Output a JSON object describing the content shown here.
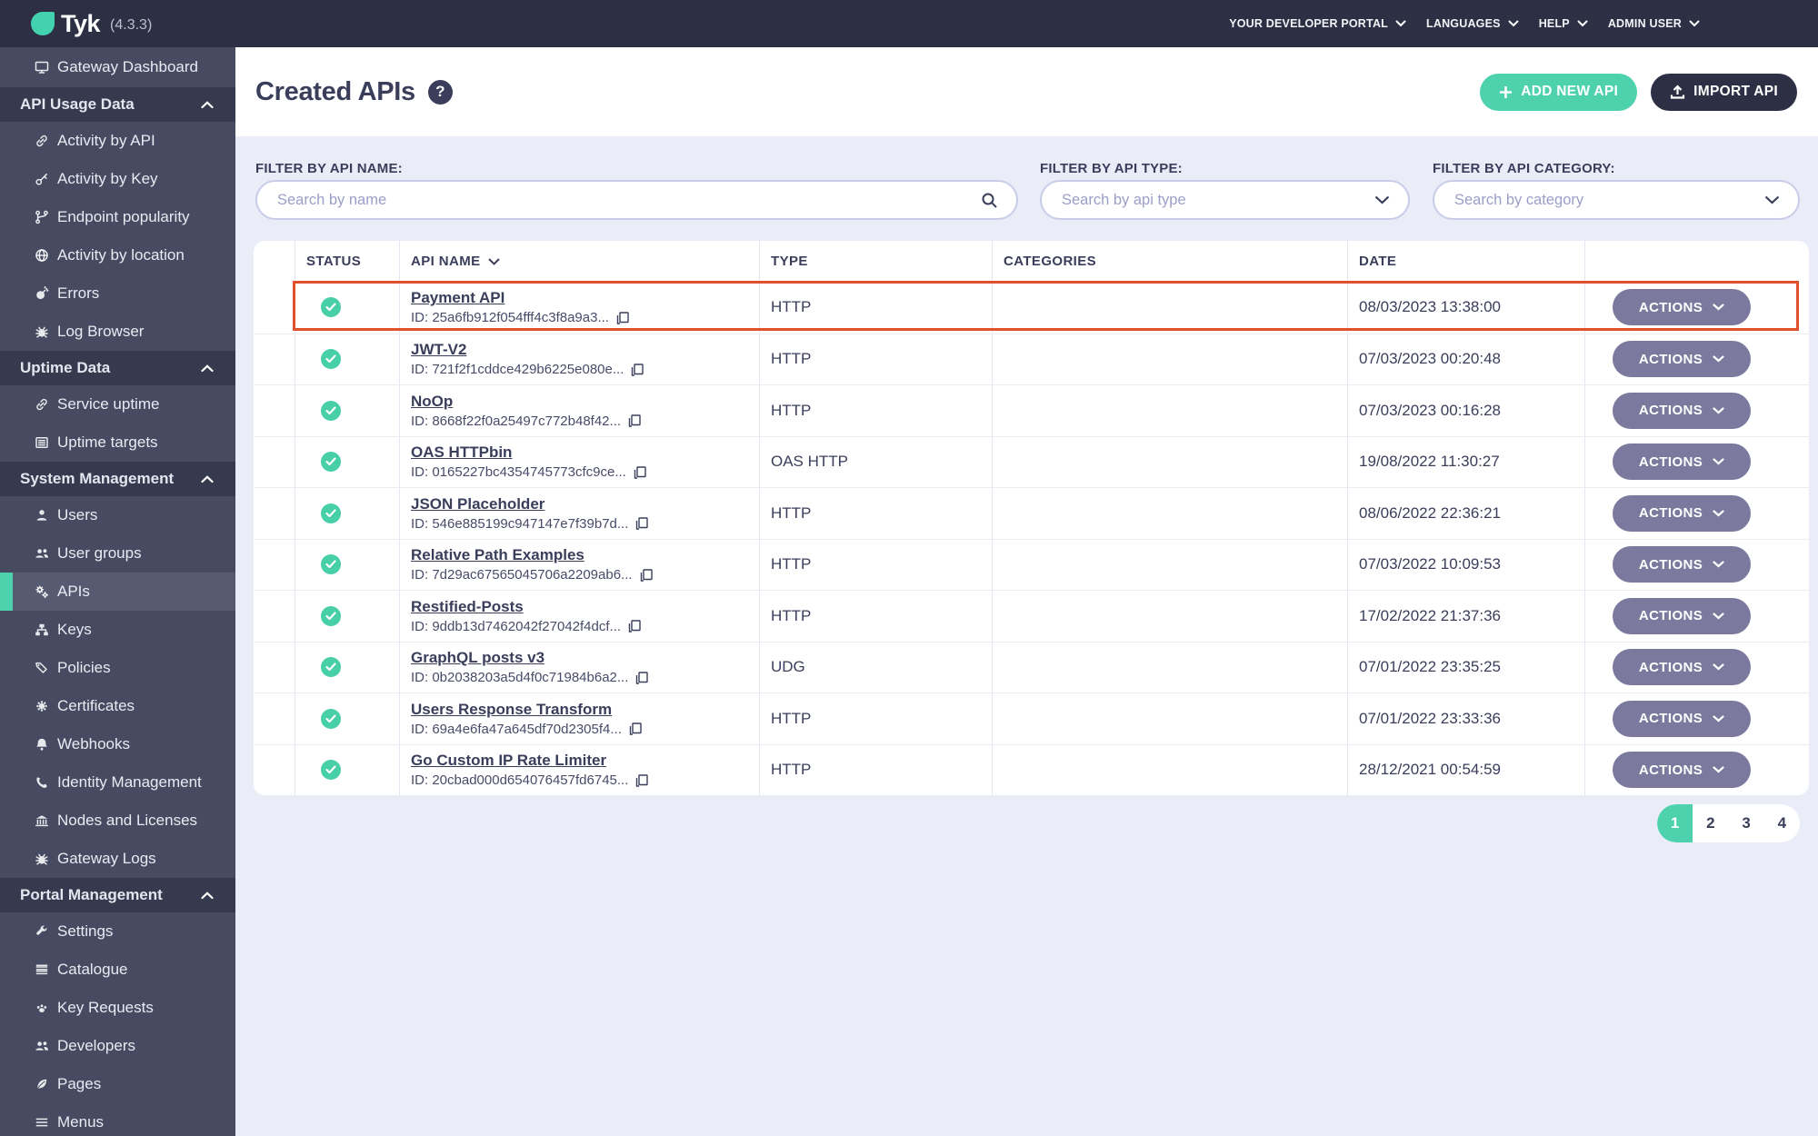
{
  "topbar": {
    "logo_text": "Tyk",
    "version": "(4.3.3)",
    "menu": [
      {
        "label": "YOUR DEVELOPER PORTAL"
      },
      {
        "label": "LANGUAGES"
      },
      {
        "label": "HELP"
      },
      {
        "label": "ADMIN USER"
      }
    ]
  },
  "sidebar": {
    "items": [
      {
        "type": "item",
        "label": "Gateway Dashboard",
        "icon": "monitor"
      },
      {
        "type": "section",
        "label": "API Usage Data"
      },
      {
        "type": "item",
        "label": "Activity by API",
        "icon": "link"
      },
      {
        "type": "item",
        "label": "Activity by Key",
        "icon": "key"
      },
      {
        "type": "item",
        "label": "Endpoint popularity",
        "icon": "branch"
      },
      {
        "type": "item",
        "label": "Activity by location",
        "icon": "globe"
      },
      {
        "type": "item",
        "label": "Errors",
        "icon": "bomb"
      },
      {
        "type": "item",
        "label": "Log Browser",
        "icon": "bug"
      },
      {
        "type": "section",
        "label": "Uptime Data"
      },
      {
        "type": "item",
        "label": "Service uptime",
        "icon": "link"
      },
      {
        "type": "item",
        "label": "Uptime targets",
        "icon": "listalt"
      },
      {
        "type": "section",
        "label": "System Management"
      },
      {
        "type": "item",
        "label": "Users",
        "icon": "user"
      },
      {
        "type": "item",
        "label": "User groups",
        "icon": "users"
      },
      {
        "type": "item",
        "label": "APIs",
        "icon": "gears",
        "selected": true
      },
      {
        "type": "item",
        "label": "Keys",
        "icon": "sitemap"
      },
      {
        "type": "item",
        "label": "Policies",
        "icon": "tags"
      },
      {
        "type": "item",
        "label": "Certificates",
        "icon": "seal"
      },
      {
        "type": "item",
        "label": "Webhooks",
        "icon": "bell"
      },
      {
        "type": "item",
        "label": "Identity Management",
        "icon": "phone"
      },
      {
        "type": "item",
        "label": "Nodes and Licenses",
        "icon": "bank"
      },
      {
        "type": "item",
        "label": "Gateway Logs",
        "icon": "bug"
      },
      {
        "type": "section",
        "label": "Portal Management"
      },
      {
        "type": "item",
        "label": "Settings",
        "icon": "wrench"
      },
      {
        "type": "item",
        "label": "Catalogue",
        "icon": "catalogue"
      },
      {
        "type": "item",
        "label": "Key Requests",
        "icon": "paw"
      },
      {
        "type": "item",
        "label": "Developers",
        "icon": "users"
      },
      {
        "type": "item",
        "label": "Pages",
        "icon": "leaf"
      },
      {
        "type": "item",
        "label": "Menus",
        "icon": "bars"
      }
    ]
  },
  "header": {
    "title": "Created APIs",
    "help_glyph": "?",
    "add_button": "ADD NEW API",
    "import_button": "IMPORT API"
  },
  "filters": [
    {
      "label": "FILTER BY API NAME:",
      "placeholder": "Search by name"
    },
    {
      "label": "FILTER BY API TYPE:",
      "placeholder": "Search by api type"
    },
    {
      "label": "FILTER BY API CATEGORY:",
      "placeholder": "Search by category"
    }
  ],
  "table": {
    "columns": [
      "",
      "STATUS",
      "API NAME",
      "TYPE",
      "CATEGORIES",
      "DATE",
      ""
    ],
    "actions_label": "ACTIONS",
    "rows": [
      {
        "status": "active",
        "name": "Payment API",
        "id": "ID: 25a6fb912f054fff4c3f8a9a3...",
        "type": "HTTP",
        "categories": "",
        "date": "08/03/2023 13:38:00",
        "highlighted": true
      },
      {
        "status": "active",
        "name": "JWT-V2",
        "id": "ID: 721f2f1cddce429b6225e080e...",
        "type": "HTTP",
        "categories": "",
        "date": "07/03/2023 00:20:48"
      },
      {
        "status": "active",
        "name": "NoOp",
        "id": "ID: 8668f22f0a25497c772b48f42...",
        "type": "HTTP",
        "categories": "",
        "date": "07/03/2023 00:16:28"
      },
      {
        "status": "active",
        "name": "OAS HTTPbin",
        "id": "ID: 0165227bc4354745773cfc9ce...",
        "type": "OAS HTTP",
        "categories": "",
        "date": "19/08/2022 11:30:27"
      },
      {
        "status": "active",
        "name": "JSON Placeholder",
        "id": "ID: 546e885199c947147e7f39b7d...",
        "type": "HTTP",
        "categories": "",
        "date": "08/06/2022 22:36:21"
      },
      {
        "status": "active",
        "name": "Relative Path Examples",
        "id": "ID: 7d29ac67565045706a2209ab6...",
        "type": "HTTP",
        "categories": "",
        "date": "07/03/2022 10:09:53"
      },
      {
        "status": "active",
        "name": "Restified-Posts",
        "id": "ID: 9ddb13d7462042f27042f4dcf...",
        "type": "HTTP",
        "categories": "",
        "date": "17/02/2022 21:37:36"
      },
      {
        "status": "active",
        "name": "GraphQL posts v3",
        "id": "ID: 0b2038203a5d4f0c71984b6a2...",
        "type": "UDG",
        "categories": "",
        "date": "07/01/2022 23:35:25"
      },
      {
        "status": "active",
        "name": "Users Response Transform",
        "id": "ID: 69a4e6fa47a645df70d2305f4...",
        "type": "HTTP",
        "categories": "",
        "date": "07/01/2022 23:33:36"
      },
      {
        "status": "active",
        "name": "Go Custom IP Rate Limiter",
        "id": "ID: 20cbad000d654076457fd6745...",
        "type": "HTTP",
        "categories": "",
        "date": "28/12/2021 00:54:59"
      }
    ]
  },
  "pagination": {
    "pages": [
      "1",
      "2",
      "3",
      "4"
    ],
    "active": "1"
  },
  "colors": {
    "accent_teal": "#4dd2ad",
    "topbar_navy": "#2d3044",
    "sidebar_slate": "#464b61",
    "highlight_red": "#e0502f",
    "actions_gray": "#7b7a9e",
    "status_green": "#47cfa8",
    "text_navy": "#3a3e5b"
  }
}
